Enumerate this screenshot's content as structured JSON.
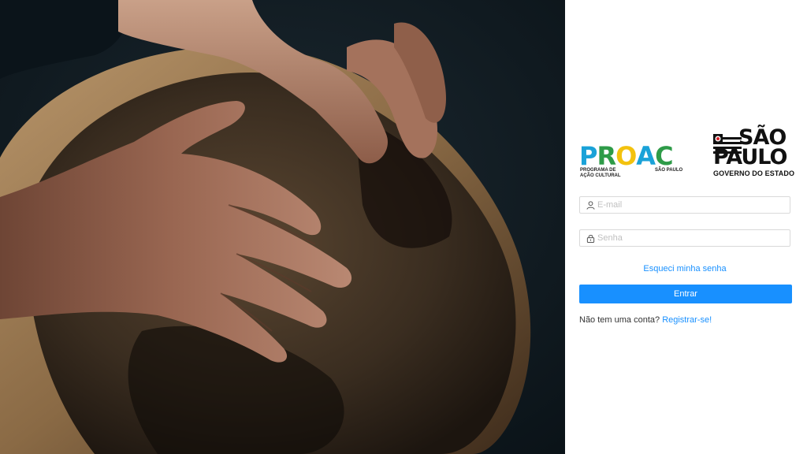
{
  "hero": {
    "image": "hands-playing-drum-photo"
  },
  "logos": {
    "proac": {
      "letters": [
        "P",
        "R",
        "O",
        "A",
        "C"
      ],
      "letter_colors": [
        "#1aa2d8",
        "#2e9b48",
        "#f3c20e",
        "#1aa2d8",
        "#2e9b48"
      ],
      "subtitle_line1": "PROGRAMA DE",
      "subtitle_line2": "AÇÃO CULTURAL",
      "region": "SÃO PAULO"
    },
    "sp": {
      "line1": "SÃO",
      "line2": "PAULO",
      "line3": "GOVERNO DO ESTADO"
    }
  },
  "form": {
    "email": {
      "placeholder": "E-mail",
      "value": "",
      "icon": "user-icon"
    },
    "password": {
      "placeholder": "Senha",
      "value": "",
      "icon": "lock-icon"
    },
    "forgot_label": "Esqueci minha senha",
    "submit_label": "Entrar",
    "signup_prompt": "Não tem uma conta?",
    "signup_link": "Registrar-se!"
  },
  "colors": {
    "accent": "#1890ff",
    "border": "#d9d9d9",
    "placeholder": "#bfbfbf"
  }
}
